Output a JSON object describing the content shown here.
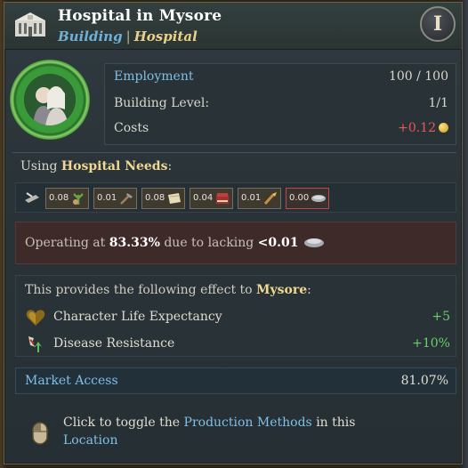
{
  "header": {
    "title": "Hospital in Mysore",
    "subtitle_building": "Building",
    "subtitle_sep": "|",
    "subtitle_type": "Hospital",
    "info_glyph": "I"
  },
  "stats": {
    "employment_label": "Employment",
    "employment_value": "100 / 100",
    "level_label": "Building Level:",
    "level_value": "1/1",
    "costs_label": "Costs",
    "costs_value": "+0.12"
  },
  "needs": {
    "prefix": "Using",
    "name": "Hospital Needs",
    "suffix": ":",
    "items": [
      {
        "amount": "0.08",
        "icon": "herb-icon"
      },
      {
        "amount": "0.01",
        "icon": "tools-icon"
      },
      {
        "amount": "0.08",
        "icon": "cloth-icon"
      },
      {
        "amount": "0.04",
        "icon": "books-icon"
      },
      {
        "amount": "0.01",
        "icon": "brush-icon"
      },
      {
        "amount": "0.00",
        "icon": "metal-icon"
      }
    ]
  },
  "warning": {
    "prefix": "Operating at",
    "percent": "83.33%",
    "middle": "due to lacking",
    "amount": "<0.01"
  },
  "effects": {
    "head_prefix": "This provides the following effect to",
    "head_location": "Mysore",
    "head_suffix": ":",
    "rows": [
      {
        "label": "Character Life Expectancy",
        "value": "+5"
      },
      {
        "label": "Disease Resistance",
        "value": "+10%"
      }
    ]
  },
  "market": {
    "label": "Market Access",
    "value": "81.07%"
  },
  "hint": {
    "prefix": "Click to toggle the",
    "link": "Production Methods",
    "suffix": "in this",
    "link2": "Location"
  },
  "colors": {
    "accent_blue": "#7fbfe8",
    "gold": "#f0d890",
    "negative": "#e85a5a",
    "positive": "#6ad06a"
  }
}
